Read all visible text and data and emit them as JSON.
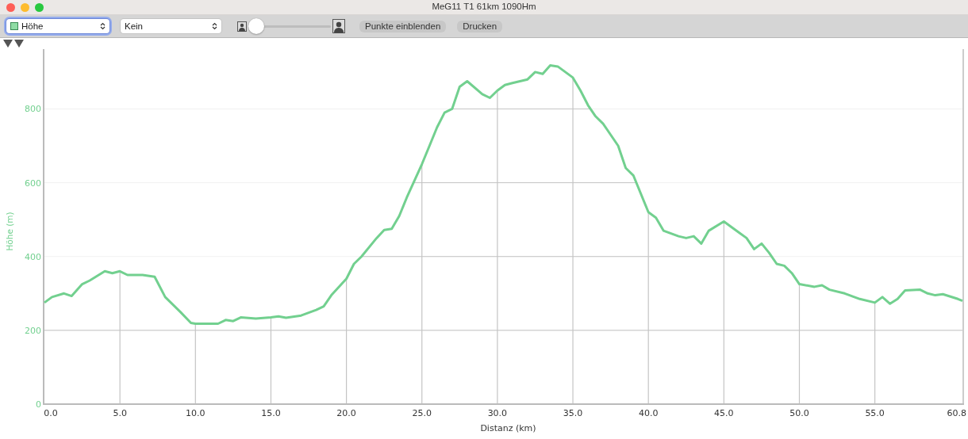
{
  "window": {
    "title": "MeG11 T1 61km 1090Hm"
  },
  "toolbar": {
    "dropdowns": [
      {
        "value": "Höhe",
        "focused": true,
        "swatch": true
      },
      {
        "value": "Kein",
        "focused": false,
        "swatch": false
      }
    ],
    "zoom_slider": {
      "level": 0
    },
    "buttons": [
      "Punkte einblenden",
      "Drucken"
    ]
  },
  "chart": {
    "chart_data": {
      "type": "line",
      "xlabel": "Distanz (km)",
      "ylabel": "Höhe (m)",
      "x": [
        0,
        0.5,
        1.3,
        1.8,
        2.5,
        3,
        4,
        4.5,
        5,
        5.5,
        6.5,
        7.3,
        8,
        9,
        9.7,
        10,
        11,
        11.5,
        12,
        12.5,
        13,
        14,
        15,
        15.5,
        16,
        17,
        18,
        18.5,
        19,
        20,
        20.5,
        21,
        22,
        22.5,
        23,
        23.5,
        24,
        25,
        25.5,
        26,
        26.5,
        27,
        27.5,
        28,
        29,
        29.5,
        30,
        30.5,
        31,
        32,
        32.5,
        33,
        33.5,
        34,
        35,
        35.5,
        36,
        36.5,
        37,
        38,
        38.5,
        39,
        40,
        40.5,
        41,
        42,
        42.5,
        43,
        43.5,
        44,
        45,
        45.5,
        46,
        46.5,
        47,
        47.5,
        48,
        48.5,
        49,
        49.5,
        50,
        51,
        51.5,
        52,
        53,
        54,
        55,
        55.5,
        56,
        56.5,
        57,
        58,
        58.5,
        59,
        59.5,
        60.5,
        60.8
      ],
      "grid": true,
      "series": [
        {
          "color": "#72d08f",
          "values": [
            275,
            290,
            300,
            293,
            325,
            335,
            360,
            355,
            360,
            350,
            350,
            345,
            290,
            250,
            220,
            218,
            218,
            218,
            228,
            225,
            235,
            232,
            235,
            238,
            234,
            240,
            255,
            265,
            295,
            340,
            380,
            400,
            450,
            472,
            475,
            510,
            560,
            650,
            700,
            750,
            790,
            800,
            860,
            875,
            840,
            830,
            850,
            865,
            870,
            880,
            900,
            895,
            918,
            915,
            885,
            850,
            810,
            780,
            760,
            700,
            640,
            620,
            520,
            505,
            470,
            455,
            450,
            455,
            435,
            470,
            495,
            480,
            465,
            450,
            420,
            435,
            410,
            380,
            375,
            355,
            325,
            318,
            322,
            310,
            300,
            285,
            275,
            290,
            272,
            285,
            308,
            310,
            300,
            295,
            298,
            285,
            280
          ]
        }
      ],
      "xlim": [
        0,
        60.8
      ],
      "ylim": [
        0,
        962
      ],
      "xticks": [
        {
          "value": 0,
          "label": "0.0"
        },
        {
          "value": 5,
          "label": "5.0"
        },
        {
          "value": 10,
          "label": "10.0"
        },
        {
          "value": 15,
          "label": "15.0"
        },
        {
          "value": 20,
          "label": "20.0"
        },
        {
          "value": 25,
          "label": "25.0"
        },
        {
          "value": 30,
          "label": "30.0"
        },
        {
          "value": 35,
          "label": "35.0"
        },
        {
          "value": 40,
          "label": "40.0"
        },
        {
          "value": 45,
          "label": "45.0"
        },
        {
          "value": 50,
          "label": "50.0"
        },
        {
          "value": 55,
          "label": "55.0"
        },
        {
          "value": 60.8,
          "label": "60.8"
        }
      ],
      "yticks": [
        0,
        200,
        400,
        600,
        800
      ]
    }
  }
}
